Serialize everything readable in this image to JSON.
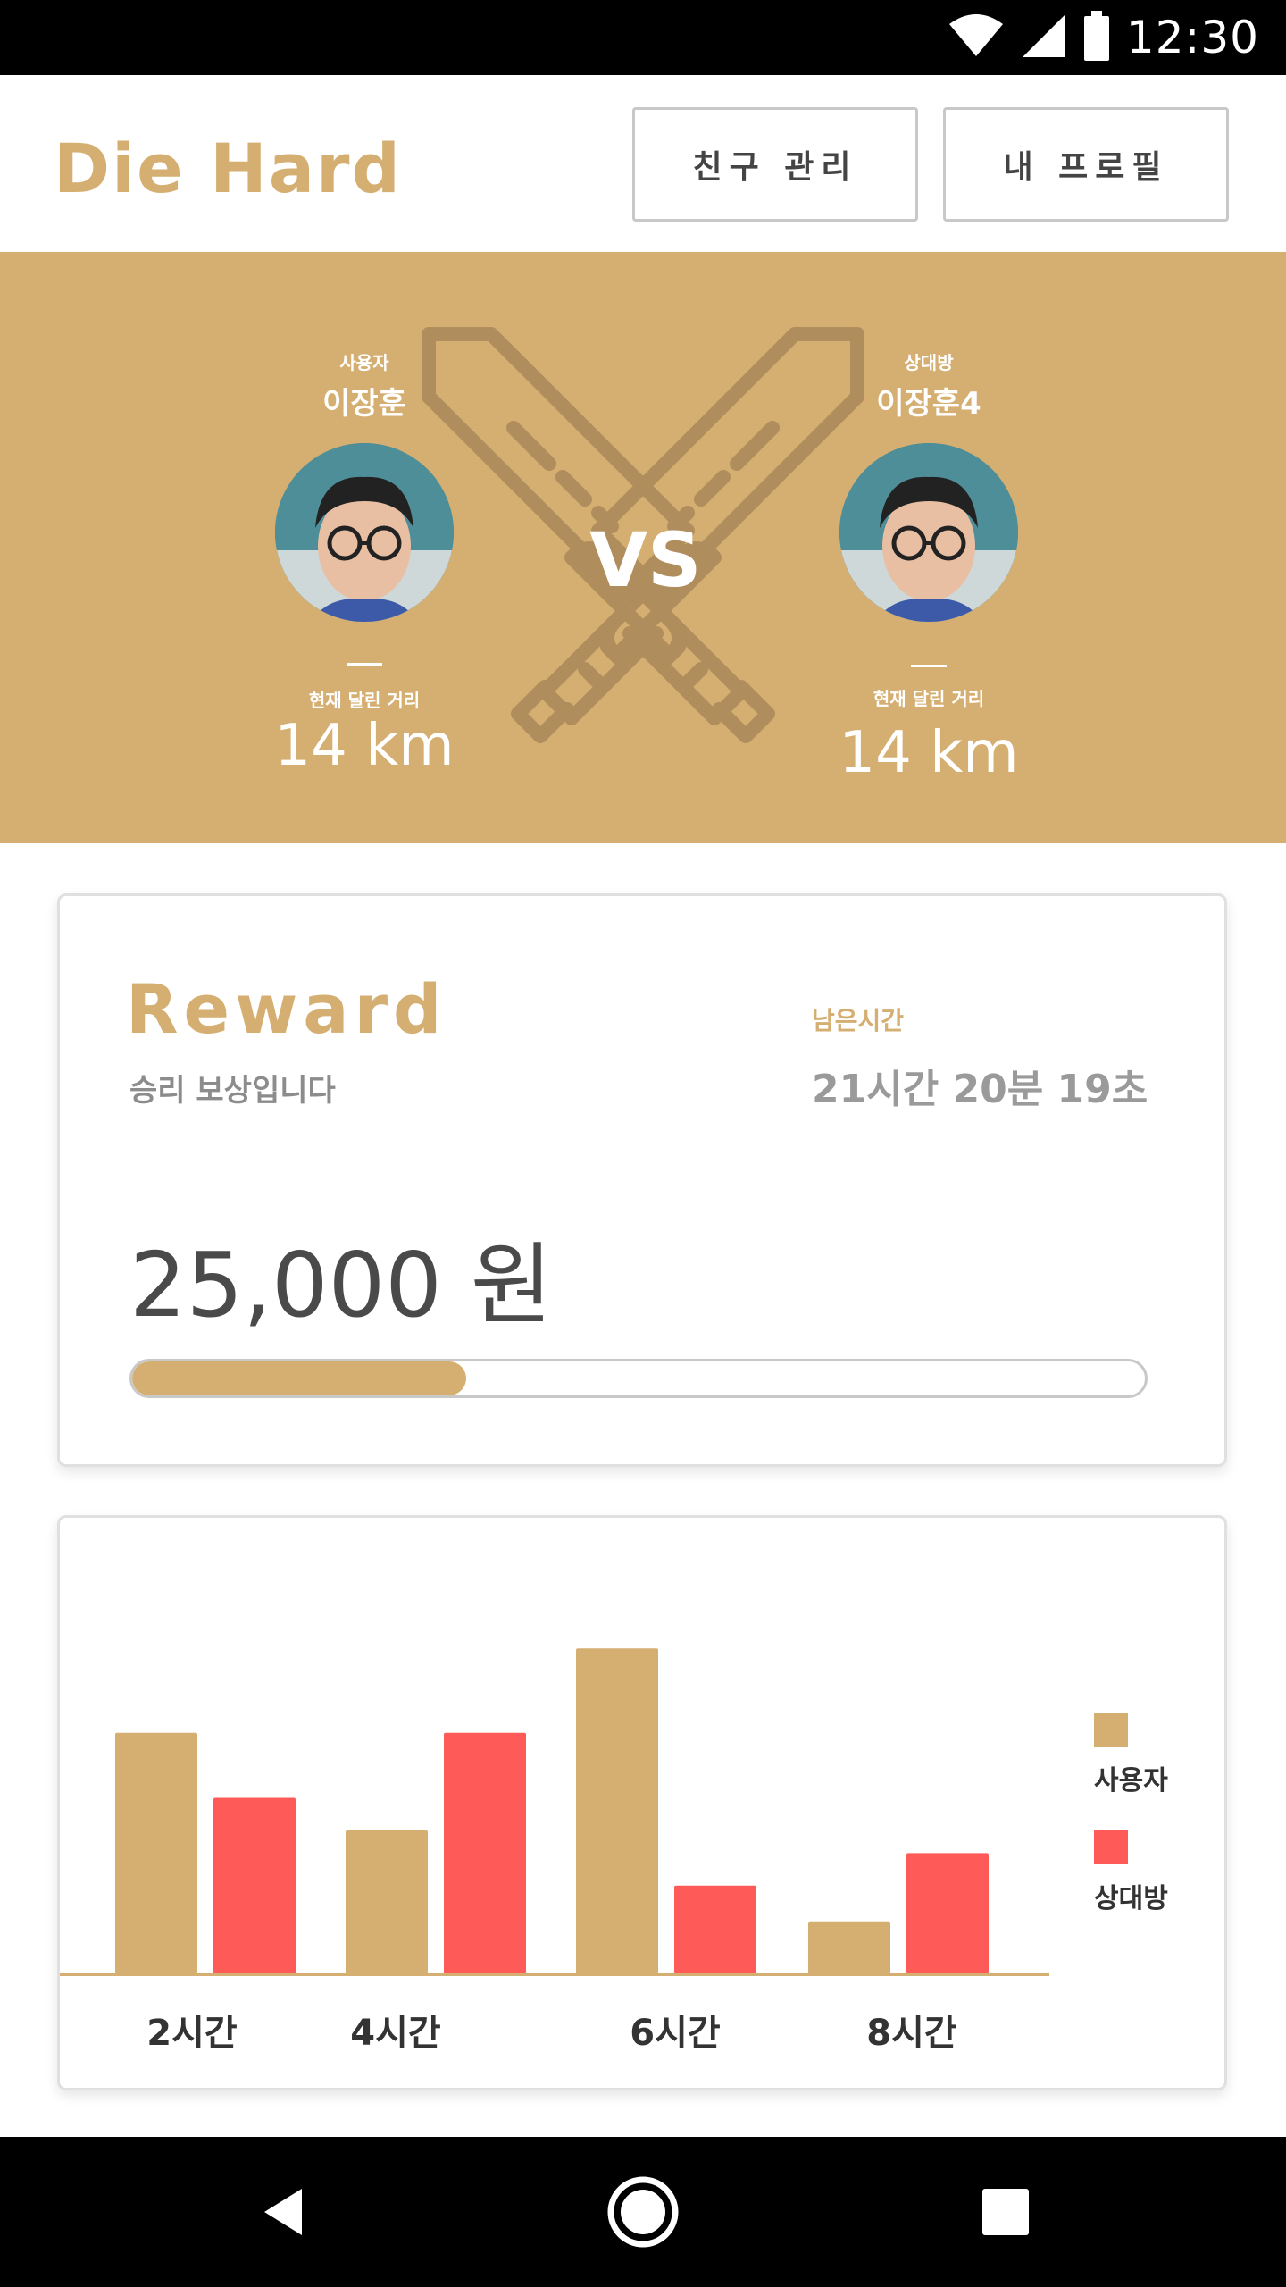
{
  "status_bar": {
    "time": "12:30",
    "icons": [
      "wifi-icon",
      "signal-icon",
      "battery-icon"
    ]
  },
  "header": {
    "app_name": "Die Hard",
    "friends_button": "친구 관리",
    "profile_button": "내 프로필"
  },
  "versus": {
    "vs_label": "VS",
    "user": {
      "role": "사용자",
      "name": "이장훈",
      "distance_label": "현재 달린 거리",
      "distance": "14 km"
    },
    "opponent": {
      "role": "상대방",
      "name": "이장훈4",
      "distance_label": "현재 달린 거리",
      "distance": "14 km"
    }
  },
  "reward": {
    "title": "Reward",
    "subtitle": "승리 보상입니다",
    "remaining_label": "남은시간",
    "remaining_value": "21시간 20분 19초",
    "amount": "25,000 원",
    "progress_fraction": 0.33
  },
  "chart_data": {
    "type": "bar",
    "categories": [
      "2시간",
      "4시간",
      "6시간",
      "8시간"
    ],
    "series": [
      {
        "name": "사용자",
        "values": [
          7.4,
          4.4,
          10.0,
          1.6
        ],
        "color": "#d5ae71"
      },
      {
        "name": "상대방",
        "values": [
          5.4,
          7.4,
          2.7,
          3.7
        ],
        "color": "#fe5a57"
      }
    ],
    "ylim": [
      0,
      10.5
    ],
    "legend_position": "right",
    "grid": false
  },
  "colors": {
    "accent": "#d5ae71",
    "opponent": "#fe5a57",
    "sword": "#b08d5c"
  },
  "nav": {
    "icons": [
      "back-icon",
      "home-icon",
      "recents-icon"
    ]
  }
}
